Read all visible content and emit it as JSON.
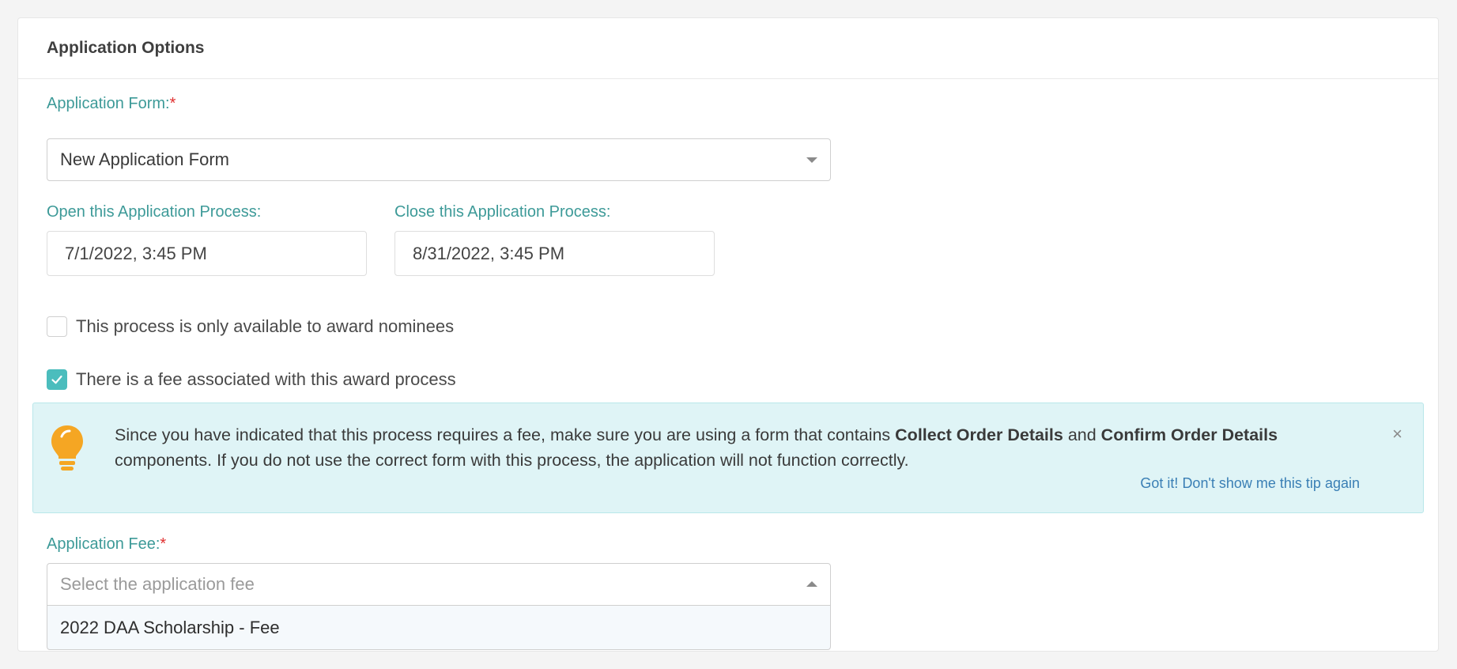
{
  "panel": {
    "title": "Application Options"
  },
  "application_form": {
    "label": "Application Form:",
    "required_mark": "*",
    "selected": "New Application Form"
  },
  "open_process": {
    "label": "Open this Application Process:",
    "value": "7/1/2022, 3:45 PM"
  },
  "close_process": {
    "label": "Close this Application Process:",
    "value": "8/31/2022, 3:45 PM"
  },
  "checkboxes": {
    "nominees_only": {
      "label": "This process is only available to award nominees",
      "checked": false
    },
    "has_fee": {
      "label": "There is a fee associated with this award process",
      "checked": true
    }
  },
  "tip": {
    "text_1": "Since you have indicated that this process requires a fee, make sure you are using a form that contains ",
    "bold_1": "Collect Order Details",
    "text_2": " and ",
    "bold_2": "Confirm Order Details",
    "text_3": " components. If you do not use the correct form with this process, the application will not function correctly.",
    "dismiss_link": "Got it! Don't show me this tip again",
    "close_glyph": "×",
    "icon": "lightbulb-icon"
  },
  "application_fee": {
    "label": "Application Fee:",
    "required_mark": "*",
    "placeholder": "Select the application fee",
    "options": [
      "2022 DAA Scholarship - Fee"
    ]
  },
  "colors": {
    "label_teal": "#3d9a98",
    "required_red": "#e03030",
    "checkbox_checked": "#4bbdbd",
    "tip_background": "#dff4f6",
    "bulb_orange": "#f5a623",
    "link_blue": "#3a7fb5"
  }
}
